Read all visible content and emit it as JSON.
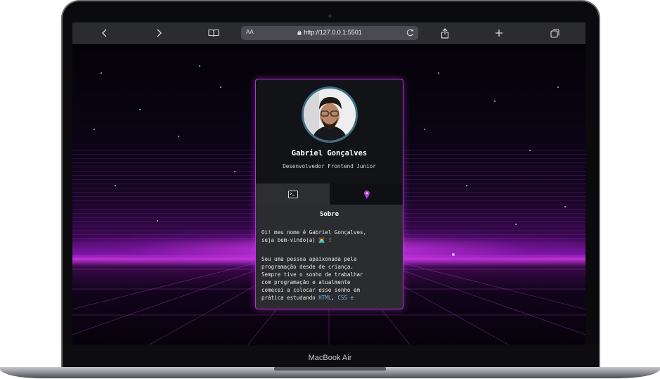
{
  "browser": {
    "url_text_size": "AA",
    "url": "http://127.0.0.1:5501",
    "icons": [
      "back-icon",
      "forward-icon",
      "bookmarks-icon",
      "lock-icon",
      "reload-icon",
      "share-icon",
      "new-tab-icon",
      "tabs-icon"
    ]
  },
  "profile": {
    "name": "Gabriel Gonçalves",
    "role": "Desenvolvedor Frontend Junior"
  },
  "tabs": [
    {
      "icon": "terminal-icon",
      "active": true
    },
    {
      "icon": "pin-icon",
      "active": false
    }
  ],
  "about": {
    "title": "Sobre",
    "paragraph1": "Oi! meu nome é Gabriel Gonçalves,\nseja bem-vindo(a) 👨‍💻 !",
    "paragraph2_prefix": "Sou uma pessoa apaixonada pela\nprogramação desde de criança.\nSempre tive o sonho de trabalhar\ncom programação e atualmente\ncomecei a colocar esse sonho em\nprática estudando ",
    "link_html": "HTML",
    "link_css": "CSS",
    "conjunction": "e"
  },
  "device_label": "MacBook Air",
  "colors": {
    "accent": "#b931d8",
    "card_bg": "#111317",
    "content_bg": "#2a2c2f",
    "link": "#7ab7e8"
  }
}
